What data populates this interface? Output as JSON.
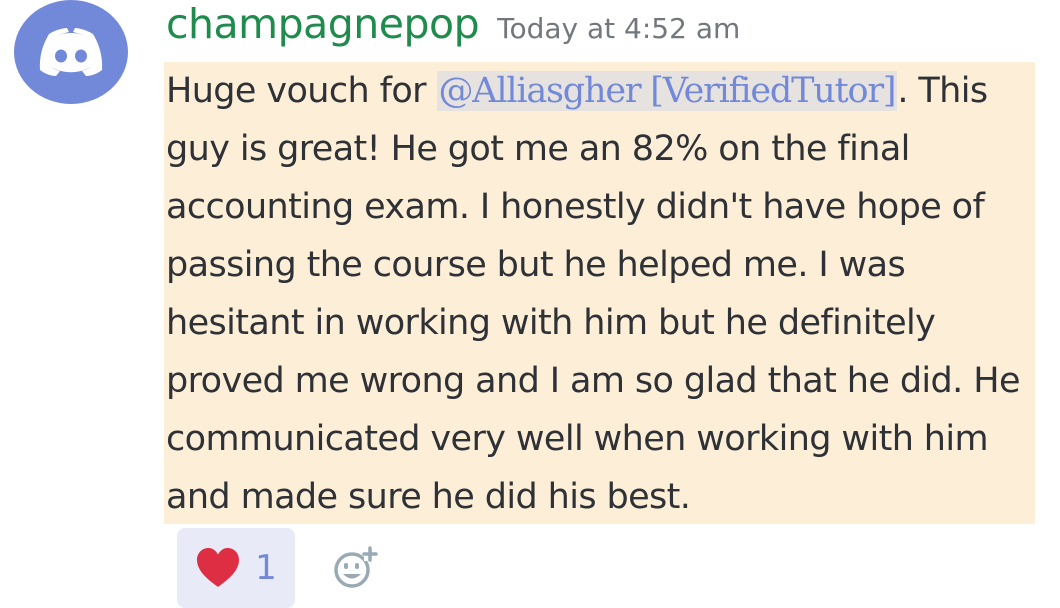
{
  "message": {
    "author": "champagnepop",
    "timestamp": "Today at 4:52 am",
    "avatar_icon": "discord-logo-icon",
    "highlight_color": "#fdeed8",
    "lines": [
      {
        "before": "Huge vouch for ",
        "mention": "@Alliasgher [VerifiedTutor]",
        "after": ". This"
      },
      {
        "text": "guy is great! He got me an 82% on the final"
      },
      {
        "text": "accounting exam.  I honestly didn't have hope of"
      },
      {
        "text": "passing the course but he helped me. I was"
      },
      {
        "text": "hesitant in working with him but he definitely"
      },
      {
        "text": "proved me wrong and I am so glad that he did. He"
      },
      {
        "text": "communicated very well when working with him"
      },
      {
        "text": "and made sure he did his best."
      }
    ]
  },
  "reactions": [
    {
      "emoji": "heart-icon",
      "count": "1"
    }
  ],
  "add_reaction_icon": "add-reaction-icon",
  "colors": {
    "author": "#1f8b4c",
    "mention": "#7289da",
    "avatar_bg": "#7289da",
    "reaction_bg": "#e8ebf7"
  }
}
